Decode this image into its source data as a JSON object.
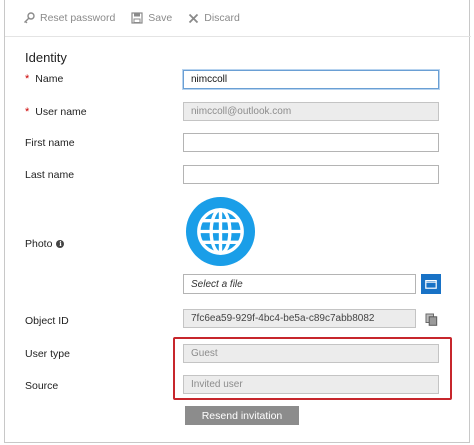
{
  "toolbar": {
    "reset_password_label": "Reset password",
    "save_label": "Save",
    "discard_label": "Discard"
  },
  "section": {
    "title": "Identity"
  },
  "labels": {
    "name": "Name",
    "user_name": "User name",
    "first_name": "First name",
    "last_name": "Last name",
    "photo": "Photo",
    "object_id": "Object ID",
    "user_type": "User type",
    "source": "Source"
  },
  "required_marker": "*",
  "fields": {
    "name": "nimccoll",
    "user_name": "nimccoll@outlook.com",
    "first_name": "",
    "last_name": "",
    "photo_file_placeholder": "Select a file",
    "object_id": "7fc6ea59-929f-4bc4-be5a-c89c7abb8082",
    "user_type": "Guest",
    "source": "Invited user"
  },
  "icons": {
    "toolbar": [
      "key-icon",
      "save-icon",
      "close-icon"
    ],
    "photo": "globe-icon",
    "browse": "folder-icon",
    "copy": "copy-icon",
    "info": "info-icon"
  },
  "colors": {
    "accent_blue": "#1872c6",
    "photo_blue": "#1a9ee8",
    "highlight_red": "#c7262c",
    "required_red": "#cc0000",
    "disabled_button": "#8c8c8c"
  },
  "actions": {
    "resend_invitation_label": "Resend invitation"
  }
}
